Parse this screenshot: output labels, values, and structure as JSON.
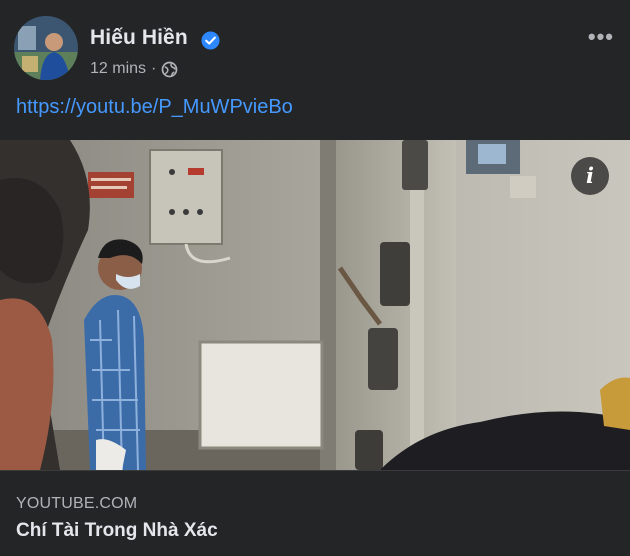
{
  "post": {
    "author": "Hiếu Hiền",
    "time": "12 mins",
    "separator": "·",
    "privacy_icon": "globe-icon",
    "more_icon": "more-options-icon",
    "verified_icon": "verified-badge-icon",
    "link_url": "https://youtu.be/P_MuWPvieBo"
  },
  "preview": {
    "info_label": "i",
    "domain": "YOUTUBE.COM",
    "title": "Chí Tài Trong Nhà Xác"
  },
  "colors": {
    "background": "#242526",
    "link": "#4599ff",
    "verified": "#2d88ff",
    "secondary_text": "#b0b3b8"
  }
}
